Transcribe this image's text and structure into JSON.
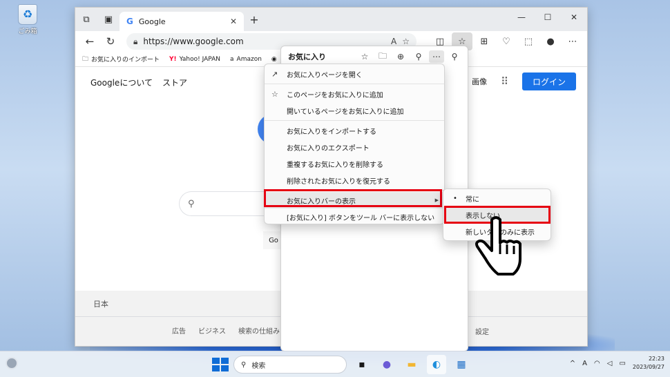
{
  "desktop": {
    "recycle_bin_label": "ごみ箱"
  },
  "browser": {
    "tab_title": "Google",
    "url": "https://www.google.com",
    "favorites_bar": [
      {
        "label": "お気に入りのインポート"
      },
      {
        "label": "Yahoo! JAPAN"
      },
      {
        "label": "Amazon"
      }
    ]
  },
  "google": {
    "top_left_links": [
      "Googleについて",
      "ストア"
    ],
    "images_link": "画像",
    "login_button": "ログイン",
    "go_stub": "Go",
    "country": "日本",
    "footer_links": [
      "広告",
      "ビジネス",
      "検索の仕組み"
    ],
    "settings": "設定"
  },
  "favorites_panel": {
    "title": "お気に入り"
  },
  "context_menu": {
    "items": [
      {
        "label": "お気に入りページを開く"
      },
      {
        "label": "このページをお気に入りに追加"
      },
      {
        "label": "開いているページをお気に入りに追加"
      },
      {
        "label": "お気に入りをインポートする"
      },
      {
        "label": "お気に入りのエクスポート"
      },
      {
        "label": "重複するお気に入りを削除する"
      },
      {
        "label": "削除されたお気に入りを復元する"
      },
      {
        "label": "お気に入りバーの表示"
      },
      {
        "label": "[お気に入り] ボタンをツール バーに表示しない"
      }
    ]
  },
  "submenu": {
    "items": [
      {
        "label": "常に",
        "selected": true
      },
      {
        "label": "表示しない"
      },
      {
        "label": "新しいタブのみに表示"
      }
    ]
  },
  "taskbar": {
    "search_placeholder": "検索",
    "time": "22:23",
    "date": "2023/09/27",
    "ime": "A"
  },
  "colors": {
    "highlight_red": "#e60012",
    "accent_blue": "#1a73e8"
  }
}
